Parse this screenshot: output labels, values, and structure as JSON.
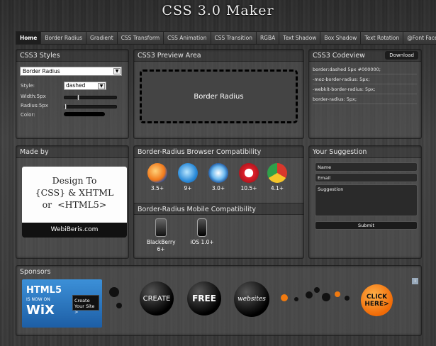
{
  "app": {
    "title": "CSS 3.0 Maker"
  },
  "nav": {
    "tabs": [
      {
        "label": "Home",
        "active": true
      },
      {
        "label": "Border Radius"
      },
      {
        "label": "Gradient"
      },
      {
        "label": "CSS Transform"
      },
      {
        "label": "CSS Animation"
      },
      {
        "label": "CSS Transition"
      },
      {
        "label": "RGBA"
      },
      {
        "label": "Text Shadow"
      },
      {
        "label": "Box Shadow"
      },
      {
        "label": "Text Rotation"
      },
      {
        "label": "@Font Face"
      }
    ]
  },
  "styles": {
    "header": "CSS3 Styles",
    "property_select": "Border Radius",
    "style_label": "Style:",
    "style_value": "dashed",
    "width_label": "Width:5px",
    "radius_label": "Radius:5px",
    "color_label": "Color:"
  },
  "preview": {
    "header": "CSS3 Preview Area",
    "box_text": "Border Radius"
  },
  "codeview": {
    "header": "CSS3 Codeview",
    "download_label": "Download",
    "lines": [
      "border:dashed 5px #000000;",
      "-moz-border-radius: 5px;",
      "-webkit-border-radius: 5px;",
      "border-radius: 5px;"
    ]
  },
  "madeby": {
    "header": "Made by",
    "card_text": "Design To\n{CSS} & XHTML\nor  <HTML5>",
    "card_footer": "WebiBeris.com"
  },
  "compat": {
    "header": "Border-Radius Browser Compatibility",
    "browsers": [
      {
        "icon": "firefox-icon",
        "version": "3.5+"
      },
      {
        "icon": "ie-icon",
        "version": "9+"
      },
      {
        "icon": "safari-icon",
        "version": "3.0+"
      },
      {
        "icon": "opera-icon",
        "version": "10.5+"
      },
      {
        "icon": "chrome-icon",
        "version": "4.1+"
      }
    ],
    "mobile_header": "Border-Radius Mobile Compatibility",
    "mobile": [
      {
        "icon": "blackberry-icon",
        "name": "BlackBerry",
        "version": "6+"
      },
      {
        "icon": "ios-icon",
        "name": "iOS 1.0+"
      }
    ]
  },
  "suggestion": {
    "header": "Your Suggestion",
    "name_placeholder": "Name",
    "email_placeholder": "Email",
    "suggestion_placeholder": "Suggestion",
    "submit_label": "Submit"
  },
  "sponsors": {
    "header": "Sponsors",
    "wix_line1": "HTML5",
    "wix_line2": "IS NOW ON",
    "wix_line3": "WiX",
    "wix_cta": "Create Your Site >",
    "bubbles": [
      "CREATE",
      "FREE",
      "websites"
    ],
    "click_here": "CLICK HERE>"
  }
}
